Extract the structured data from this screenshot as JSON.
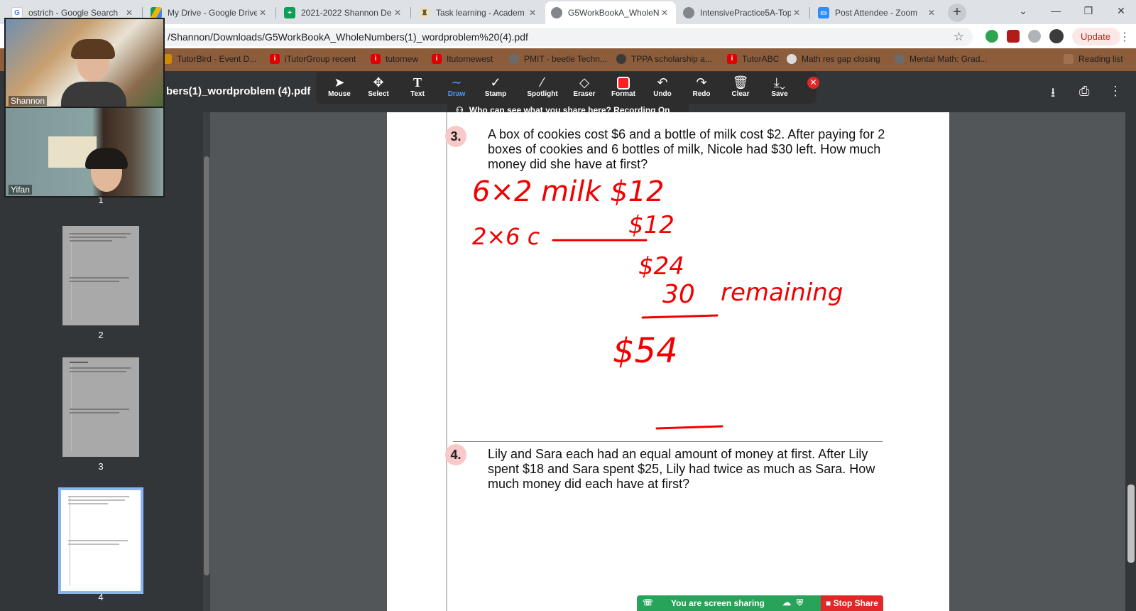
{
  "browser": {
    "tabs": [
      {
        "title": "ostrich - Google Search",
        "icon": "google-icon"
      },
      {
        "title": "My Drive - Google Drive",
        "icon": "drive-icon"
      },
      {
        "title": "2021-2022 Shannon De",
        "icon": "sheets-icon"
      },
      {
        "title": "Task learning - Academ",
        "icon": "task-icon"
      },
      {
        "title": "G5WorkBookA_WholeN",
        "icon": "globe-icon",
        "active": true
      },
      {
        "title": "IntensivePractice5A-Top",
        "icon": "globe-icon"
      },
      {
        "title": "Post Attendee - Zoom",
        "icon": "zoom-icon"
      }
    ],
    "url": "/Shannon/Downloads/G5WorkBookA_WholeNumbers(1)_wordproblem%20(4).pdf",
    "update_label": "Update",
    "bookmarks": [
      "TutorBird - Event D...",
      "iTutorGroup recent",
      "tutornew",
      "Itutornewest",
      "PMIT - beetle Techn...",
      "TPPA scholarship a...",
      "TutorABC",
      "Math res gap closing",
      "Mental Math: Grad...",
      "Reading list"
    ],
    "colors": {
      "tabbar": "#dee1e6",
      "bookmarks_bg": "#8c5c3b",
      "update_text": "#c5221f"
    }
  },
  "pdf": {
    "title": "bers(1)_wordproblem (4).pdf",
    "thumbnails": [
      {
        "label": "1"
      },
      {
        "label": "2"
      },
      {
        "label": "3"
      },
      {
        "label": "4",
        "current": true
      }
    ]
  },
  "zoom": {
    "tools": [
      "Mouse",
      "Select",
      "Text",
      "Draw",
      "Stamp",
      "Spotlight",
      "Eraser",
      "Format",
      "Undo",
      "Redo",
      "Clear",
      "Save"
    ],
    "active_tool": "Draw",
    "recording_notice": "Who can see what you share here? Recording On",
    "share_status": "You are screen sharing",
    "stop_share": "Stop Share",
    "participants": [
      "Shannon",
      "Yifan"
    ],
    "colors": {
      "annotation": "#ff1e1e",
      "share_bar": "#27a35a",
      "stop": "#e02828"
    }
  },
  "document": {
    "questions": [
      {
        "number": "3.",
        "text": "A box of cookies cost $6 and a bottle of milk cost $2. After paying for 2 boxes of cookies and 6 bottles of milk, Nicole had $30 left. How much money did she have at first?"
      },
      {
        "number": "4.",
        "text": "Lily and Sara each had an equal amount of money at first. After Lily spent $18 and Sara spent $25, Lily had twice as much as Sara. How much money did each have at first?"
      }
    ],
    "handwriting": {
      "line1": "6×2 milk $12",
      "line2": "2×6 c",
      "line2_value": "$12",
      "subtotal": "$24",
      "remaining_value": "30",
      "remaining_label": "remaining",
      "total": "$54"
    }
  }
}
